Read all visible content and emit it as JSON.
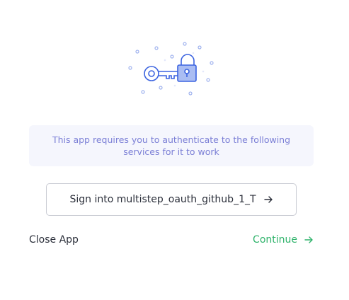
{
  "illustration": {
    "icon": "key-lock-illustration",
    "color": "#3b63e0"
  },
  "info": {
    "text": "This app requires you to authenticate to the following services for it to work"
  },
  "signin": {
    "label": "Sign into multistep_oauth_github_1_T",
    "icon": "arrow-right-icon"
  },
  "actions": {
    "close_label": "Close App",
    "continue_label": "Continue",
    "continue_color": "#2fb36b",
    "continue_icon": "arrow-right-icon"
  }
}
